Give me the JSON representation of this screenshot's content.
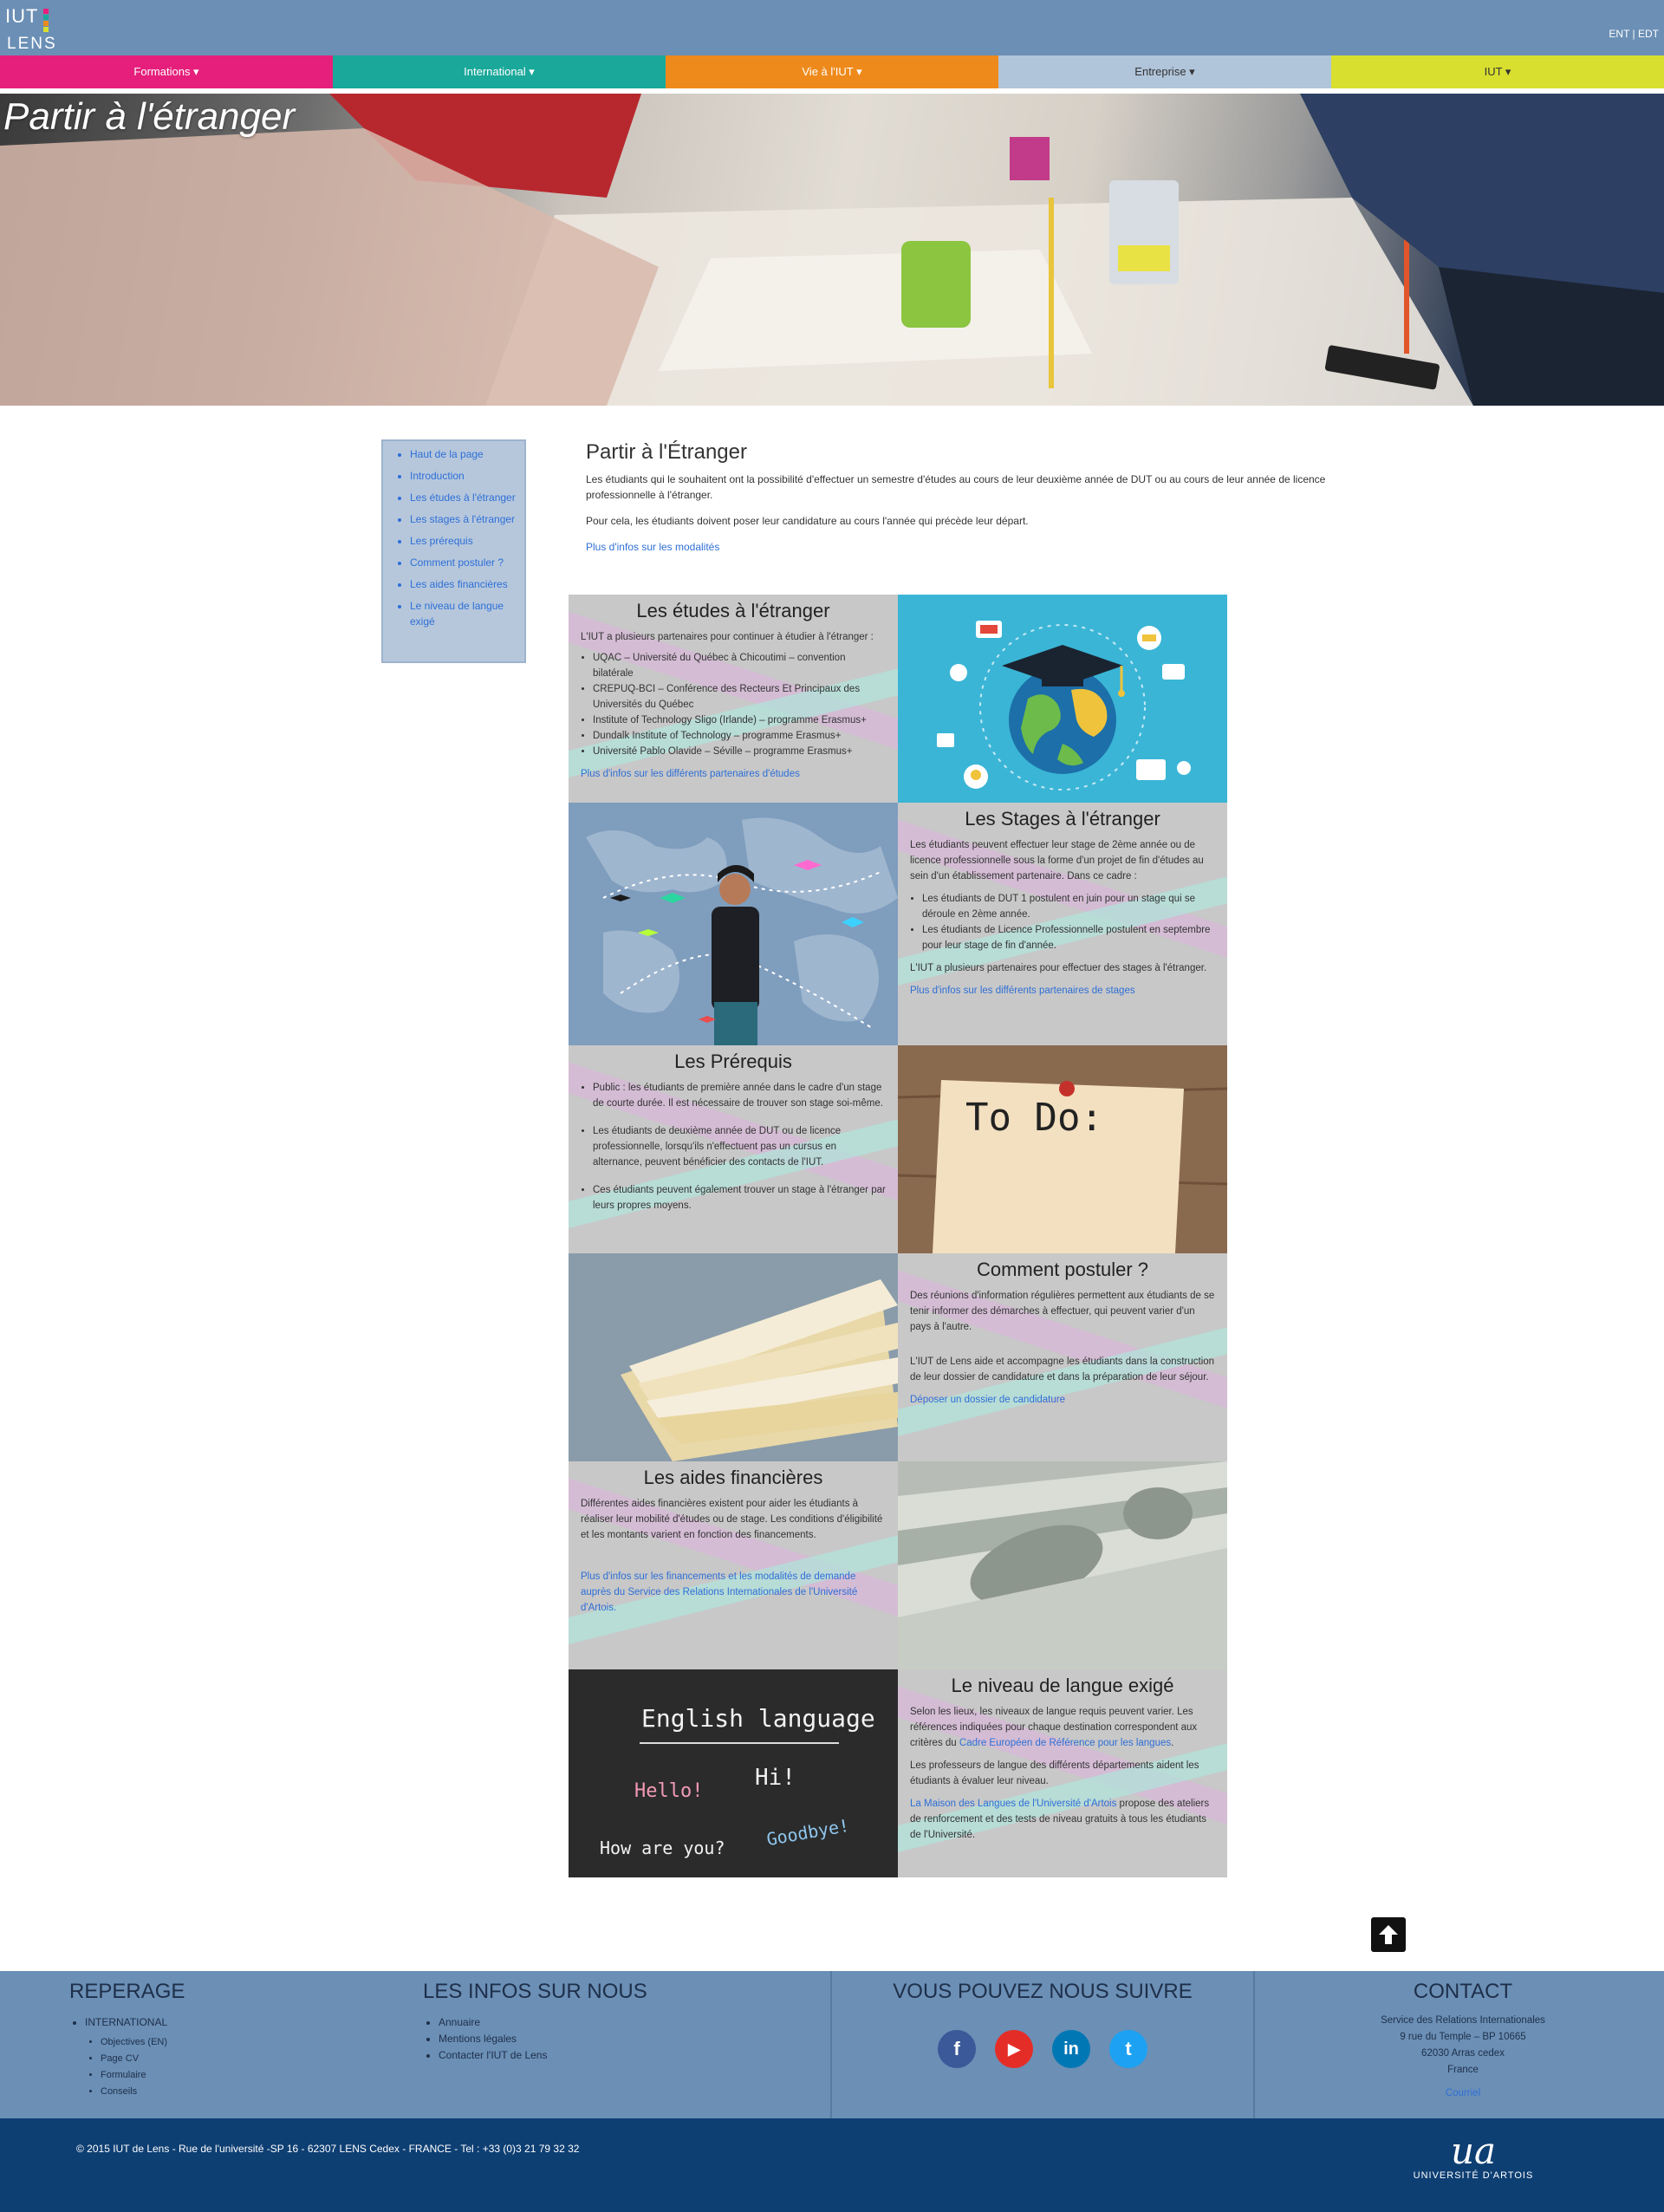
{
  "header": {
    "logo_top": "IUT",
    "logo_bottom": "LENS",
    "ent_links": "ENT | EDT"
  },
  "nav": {
    "items": [
      {
        "label": "Formations ▾",
        "color": "#e51f7b"
      },
      {
        "label": "International ▾",
        "color": "#1aa89a"
      },
      {
        "label": "Vie à l'IUT ▾",
        "color": "#ee8a1b"
      },
      {
        "label": "Entreprise ▾",
        "color": "#b0c4da"
      },
      {
        "label": "IUT ▾",
        "color": "#d9df2e"
      }
    ]
  },
  "hero": {
    "title": "Partir à l'étranger"
  },
  "sidebar": {
    "items": [
      "Haut de la page",
      "Introduction",
      "Les études à l'étranger",
      "Les stages à l'étranger",
      "Les prérequis",
      "Comment postuler ?",
      "Les aides financières",
      "Le niveau de langue exigé"
    ]
  },
  "intro": {
    "title": "Partir à l'Étranger",
    "p1": "Les étudiants qui le souhaitent ont la possibilité d'effectuer un semestre d'études au cours de leur deuxième année de DUT ou au cours de leur année de licence professionnelle à l'étranger.",
    "p2": "Pour cela, les étudiants doivent poser leur candidature au cours l'année qui précède leur départ.",
    "link": "Plus d'infos sur les modalités"
  },
  "sections": {
    "etudes": {
      "title": "Les études à l'étranger",
      "intro": "L'IUT a plusieurs partenaires pour continuer à étudier à l'étranger :",
      "items": [
        "UQAC – Université du Québec à Chicoutimi – convention bilatérale",
        "CREPUQ-BCI – Conférence des Recteurs Et Principaux des Universités du Québec",
        "Institute of Technology Sligo (Irlande) – programme Erasmus+",
        "Dundalk Institute of Technology – programme Erasmus+",
        "Université Pablo Olavide – Séville – programme Erasmus+"
      ],
      "link": "Plus d'infos sur les différents partenaires d'études"
    },
    "stages": {
      "title": "Les Stages à l'étranger",
      "p1": "Les étudiants peuvent effectuer leur stage de 2ème année ou de licence professionnelle sous la forme d'un projet de fin d'études au sein d'un établissement partenaire. Dans ce cadre :",
      "items": [
        "Les étudiants de DUT 1 postulent en juin pour un stage qui se déroule en 2ème année.",
        "Les étudiants de Licence Professionnelle postulent en septembre pour leur stage de fin d'année."
      ],
      "p2": "L'IUT a plusieurs partenaires pour effectuer des stages à l'étranger.",
      "link": "Plus d'infos sur les différents partenaires de stages"
    },
    "prerequis": {
      "title": "Les Prérequis",
      "items": [
        "Public : les étudiants de première année dans le cadre d'un stage de courte durée. Il est nécessaire de trouver son stage soi-même.",
        "Les étudiants de deuxième année de DUT ou de licence professionnelle, lorsqu'ils n'effectuent pas un cursus en alternance, peuvent bénéficier des contacts de l'IUT.",
        "Ces étudiants peuvent également trouver un stage à l'étranger par leurs propres moyens."
      ]
    },
    "postuler": {
      "title": "Comment postuler ?",
      "p1": "Des réunions d'information régulières permettent aux étudiants de se tenir informer des démarches à effectuer, qui peuvent varier d'un pays à l'autre.",
      "p2": "L'IUT de Lens aide et accompagne les étudiants dans la construction de leur dossier de candidature et dans la préparation de leur séjour.",
      "link": "Déposer un dossier de candidature"
    },
    "aides": {
      "title": "Les aides financières",
      "p1": "Différentes aides financières existent pour aider les étudiants à réaliser leur mobilité d'études ou de stage. Les conditions d'éligibilité et les montants varient en fonction des financements.",
      "link": "Plus d'infos sur les financements et les modalités de demande auprès du Service des Relations Internationales de l'Université d'Artois."
    },
    "langue": {
      "title": "Le niveau de langue exigé",
      "p1_a": "Selon les lieux, les niveaux de langue requis peuvent varier. Les références indiquées pour chaque destination correspondent aux critères du ",
      "p1_link": "Cadre Européen de Référence pour les langues",
      "p1_b": ".",
      "p2": "Les professeurs de langue des différents départements aident les étudiants à évaluer leur niveau.",
      "p3_link": "La Maison des Langues de l'Université d'Artois",
      "p3_b": " propose des ateliers de renforcement et des tests de niveau gratuits à tous les étudiants de l'Université."
    }
  },
  "images": {
    "chalk_title": "English language",
    "chalk_hello": "Hello!",
    "chalk_hi": "Hi!",
    "chalk_how": "How are you?",
    "chalk_goodbye": "Goodbye!",
    "todo": "To Do:"
  },
  "footer": {
    "reperage": {
      "title": "REPERAGE",
      "top_item": "INTERNATIONAL",
      "items": [
        "Objectives (EN)",
        "Page CV",
        "Formulaire",
        "Conseils"
      ]
    },
    "infos": {
      "title": "LES INFOS SUR NOUS",
      "items": [
        "Annuaire",
        "Mentions légales",
        "Contacter l'IUT de Lens"
      ]
    },
    "suivre": {
      "title": "VOUS POUVEZ NOUS SUIVRE",
      "facebook": "f",
      "youtube": "▶",
      "linkedin": "in",
      "twitter": "t"
    },
    "contact": {
      "title": "CONTACT",
      "lines": [
        "Service des Relations Internationales",
        "9 rue du Temple – BP 10665",
        "62030 Arras cedex",
        "France"
      ],
      "link": "Courriel"
    },
    "copyright": "© 2015 IUT de Lens - Rue de l'université -SP 16 - 62307 LENS Cedex - FRANCE - Tel : +33 (0)3 21 79 32 32",
    "university": "UNIVERSITÉ D'ARTOIS",
    "university_mark": "ua"
  }
}
